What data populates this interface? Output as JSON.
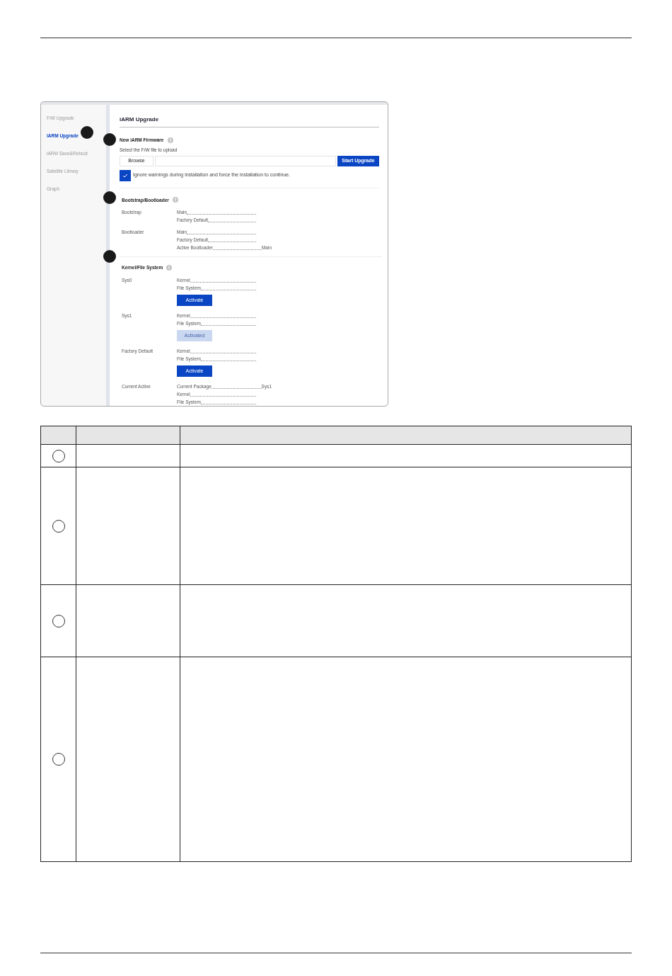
{
  "sidebar": {
    "items": [
      {
        "label": "F/W Upgrade",
        "selected": false
      },
      {
        "label": "iARM Upgrade",
        "selected": true
      },
      {
        "label": "iARM Save&Reboot",
        "selected": false
      },
      {
        "label": "Satellite Library",
        "selected": false
      },
      {
        "label": "Graph",
        "selected": false
      }
    ]
  },
  "page_title": "iARM Upgrade",
  "firmware": {
    "title": "New iARM Firmware",
    "hint": "Select the F/W file to upload",
    "browse_button": "Browse",
    "start_button": "Start Upgrade",
    "ignore_warnings": {
      "label": "Ignore warnings during installation and force the installation to continue.",
      "checked": true
    }
  },
  "bootstrap": {
    "title": "Bootstrap/Bootloader",
    "groups": [
      {
        "label": "Bootstrap",
        "lines": [
          {
            "name": "Main"
          },
          {
            "name": "Factory Default"
          }
        ]
      },
      {
        "label": "Bootloader",
        "lines": [
          {
            "name": "Main"
          },
          {
            "name": "Factory Default"
          },
          {
            "name": "Active Bootloader",
            "value": "Main"
          }
        ]
      }
    ]
  },
  "kernel": {
    "title": "Kernel/File System",
    "groups": [
      {
        "label": "Sys0",
        "lines": [
          {
            "name": "Kernel"
          },
          {
            "name": "File System"
          }
        ],
        "button": {
          "label": "Activate",
          "disabled": false
        }
      },
      {
        "label": "Sys1",
        "lines": [
          {
            "name": "Kernel"
          },
          {
            "name": "File System"
          }
        ],
        "button": {
          "label": "Activated",
          "disabled": true
        }
      },
      {
        "label": "Factory Default",
        "lines": [
          {
            "name": "Kernel"
          },
          {
            "name": "File System"
          }
        ],
        "button": {
          "label": "Activate",
          "disabled": false
        }
      },
      {
        "label": "Current Active",
        "lines": [
          {
            "name": "Current Package",
            "value": "Sys1"
          },
          {
            "name": "Kernel"
          },
          {
            "name": "File System"
          }
        ]
      }
    ]
  }
}
